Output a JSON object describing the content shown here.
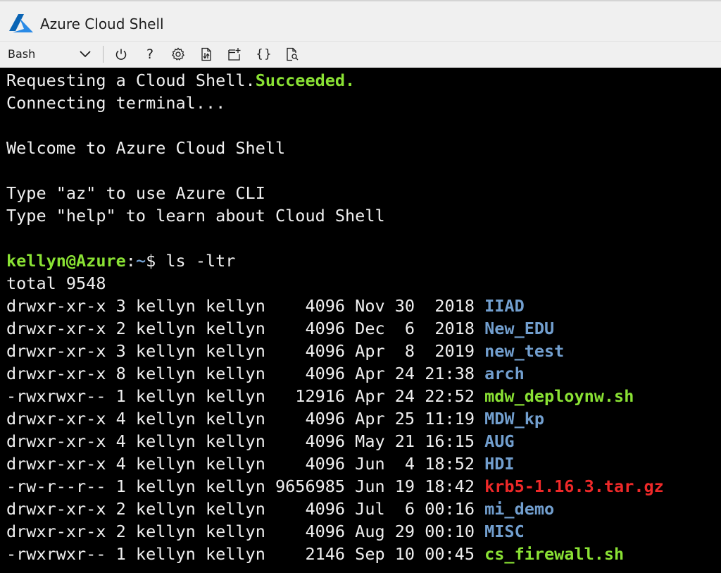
{
  "window": {
    "title": "Azure Cloud Shell"
  },
  "toolbar": {
    "shell_type": "Bash",
    "buttons": [
      {
        "name": "restart-power-button",
        "icon": "power-icon"
      },
      {
        "name": "help-button",
        "icon": "question-icon",
        "glyph": "?"
      },
      {
        "name": "settings-button",
        "icon": "gear-icon"
      },
      {
        "name": "upload-download-button",
        "icon": "file-transfer-icon"
      },
      {
        "name": "new-session-button",
        "icon": "new-window-icon"
      },
      {
        "name": "editor-button",
        "icon": "braces-icon",
        "glyph": "{}"
      },
      {
        "name": "web-preview-button",
        "icon": "web-preview-icon"
      }
    ]
  },
  "colors": {
    "terminal_bg": "#000000",
    "text": "#f0f0f0",
    "success": "#8ae234",
    "directory": "#729fcf",
    "executable": "#8ae234",
    "archive": "#ef2929",
    "azure_brand": "#0078d4"
  },
  "terminal": {
    "boot": {
      "requesting": "Requesting a Cloud Shell.",
      "status": "Succeeded.",
      "connecting": "Connecting terminal..."
    },
    "welcome": "Welcome to Azure Cloud Shell",
    "hint_az": "Type \"az\" to use Azure CLI",
    "hint_help": "Type \"help\" to learn about Cloud Shell",
    "prompt": {
      "user_host": "kellyn@Azure",
      "colon": ":",
      "path": "~",
      "symbol": "$ ",
      "command": "ls -ltr"
    },
    "total": "total 9548",
    "listing": [
      {
        "meta": "drwxr-xr-x 3 kellyn kellyn    4096 Nov 30  2018 ",
        "name": "IIAD",
        "kind": "dir"
      },
      {
        "meta": "drwxr-xr-x 2 kellyn kellyn    4096 Dec  6  2018 ",
        "name": "New_EDU",
        "kind": "dir"
      },
      {
        "meta": "drwxr-xr-x 3 kellyn kellyn    4096 Apr  8  2019 ",
        "name": "new_test",
        "kind": "dir"
      },
      {
        "meta": "drwxr-xr-x 8 kellyn kellyn    4096 Apr 24 21:38 ",
        "name": "arch",
        "kind": "dir"
      },
      {
        "meta": "-rwxrwxr-- 1 kellyn kellyn   12916 Apr 24 22:52 ",
        "name": "mdw_deploynw.sh",
        "kind": "exec"
      },
      {
        "meta": "drwxr-xr-x 4 kellyn kellyn    4096 Apr 25 11:19 ",
        "name": "MDW_kp",
        "kind": "dir"
      },
      {
        "meta": "drwxr-xr-x 4 kellyn kellyn    4096 May 21 16:15 ",
        "name": "AUG",
        "kind": "dir"
      },
      {
        "meta": "drwxr-xr-x 4 kellyn kellyn    4096 Jun  4 18:52 ",
        "name": "HDI",
        "kind": "dir"
      },
      {
        "meta": "-rw-r--r-- 1 kellyn kellyn 9656985 Jun 19 18:42 ",
        "name": "krb5-1.16.3.tar.gz",
        "kind": "archive"
      },
      {
        "meta": "drwxr-xr-x 2 kellyn kellyn    4096 Jul  6 00:16 ",
        "name": "mi_demo",
        "kind": "dir"
      },
      {
        "meta": "drwxr-xr-x 2 kellyn kellyn    4096 Aug 29 00:10 ",
        "name": "MISC",
        "kind": "dir"
      },
      {
        "meta": "-rwxrwxr-- 1 kellyn kellyn    2146 Sep 10 00:45 ",
        "name": "cs_firewall.sh",
        "kind": "exec"
      }
    ]
  }
}
